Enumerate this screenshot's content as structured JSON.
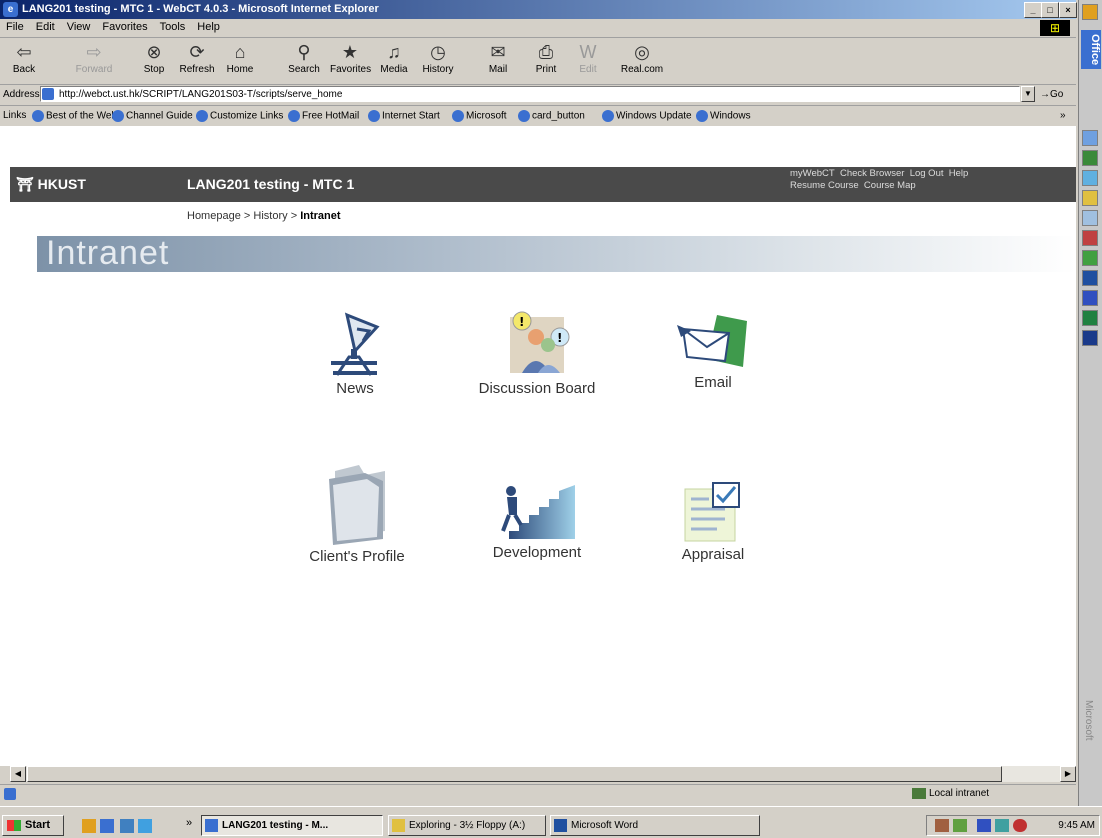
{
  "window": {
    "title": "LANG201 testing - MTC 1 - WebCT 4.0.3 - Microsoft Internet Explorer"
  },
  "menu": [
    "File",
    "Edit",
    "View",
    "Favorites",
    "Tools",
    "Help"
  ],
  "toolbar": {
    "back": "Back",
    "forward": "Forward",
    "stop": "Stop",
    "refresh": "Refresh",
    "home": "Home",
    "search": "Search",
    "favorites": "Favorites",
    "media": "Media",
    "history": "History",
    "mail": "Mail",
    "print": "Print",
    "edit": "Edit",
    "real": "Real.com"
  },
  "address": {
    "label": "Address",
    "value": "http://webct.ust.hk/SCRIPT/LANG201S03-T/scripts/serve_home",
    "go": "Go"
  },
  "links": {
    "label": "Links",
    "items": [
      "Best of the Web",
      "Channel Guide",
      "Customize Links",
      "Free HotMail",
      "Internet Start",
      "Microsoft",
      "card_button",
      "Windows Update",
      "Windows"
    ]
  },
  "webct": {
    "logo": "HKUST",
    "course_title": "LANG201 testing - MTC 1",
    "header_links": {
      "mywebct": "myWebCT",
      "check_browser": "Check Browser",
      "logout": "Log Out",
      "help": "Help",
      "resume": "Resume Course",
      "course_map": "Course Map"
    },
    "breadcrumb": {
      "home": "Homepage",
      "sep": ">",
      "history": "History",
      "current": "Intranet"
    },
    "banner": "Intranet",
    "tools": {
      "news": "News",
      "discussion": "Discussion Board",
      "email": "Email",
      "client_profile": "Client's Profile",
      "development": "Development",
      "appraisal": "Appraisal"
    }
  },
  "statusbar": {
    "zone": "Local intranet"
  },
  "taskbar": {
    "start": "Start",
    "tasks": [
      "LANG201 testing - M...",
      "Exploring - 3½ Floppy (A:)",
      "Microsoft Word"
    ],
    "clock": "9:45 AM"
  },
  "officebar": {
    "title": "Office",
    "brand": "Microsoft"
  }
}
